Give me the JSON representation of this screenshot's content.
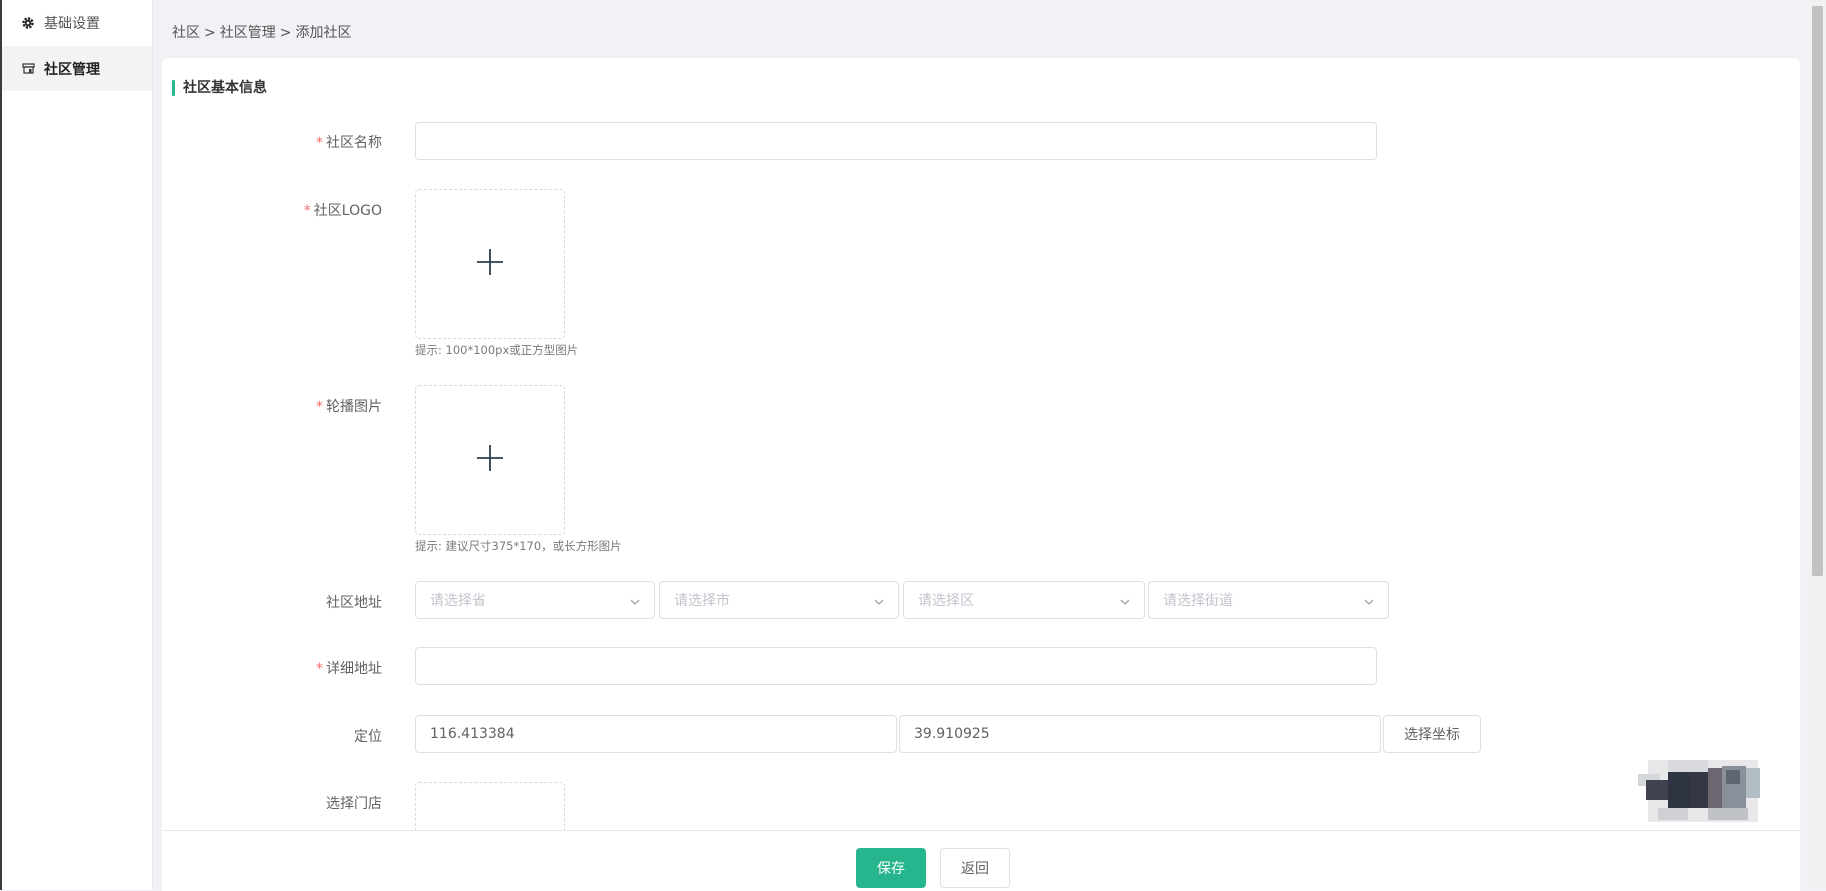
{
  "sidebar": {
    "items": [
      {
        "label": "基础设置",
        "icon": "gear-icon",
        "active": false
      },
      {
        "label": "社区管理",
        "icon": "community-icon",
        "active": true
      }
    ]
  },
  "breadcrumb": {
    "items": [
      "社区",
      "社区管理",
      "添加社区"
    ],
    "separator": ">"
  },
  "form": {
    "section_title": "社区基本信息",
    "name": {
      "label": "社区名称",
      "required": "*",
      "value": ""
    },
    "logo": {
      "label": "社区LOGO",
      "required": "*",
      "hint": "提示: 100*100px或正方型图片"
    },
    "banner": {
      "label": "轮播图片",
      "required": "*",
      "hint": "提示: 建议尺寸375*170，或长方形图片"
    },
    "address": {
      "label": "社区地址",
      "province_placeholder": "请选择省",
      "city_placeholder": "请选择市",
      "district_placeholder": "请选择区",
      "street_placeholder": "请选择街道"
    },
    "detail_address": {
      "label": "详细地址",
      "required": "*",
      "value": ""
    },
    "location": {
      "label": "定位",
      "longitude": "116.413384",
      "latitude": "39.910925",
      "button": "选择坐标"
    },
    "store": {
      "label": "选择门店"
    }
  },
  "footer": {
    "save": "保存",
    "back": "返回"
  },
  "colors": {
    "primary": "#27b58d",
    "required": "#f56c6c",
    "border": "#dcdfe6"
  }
}
